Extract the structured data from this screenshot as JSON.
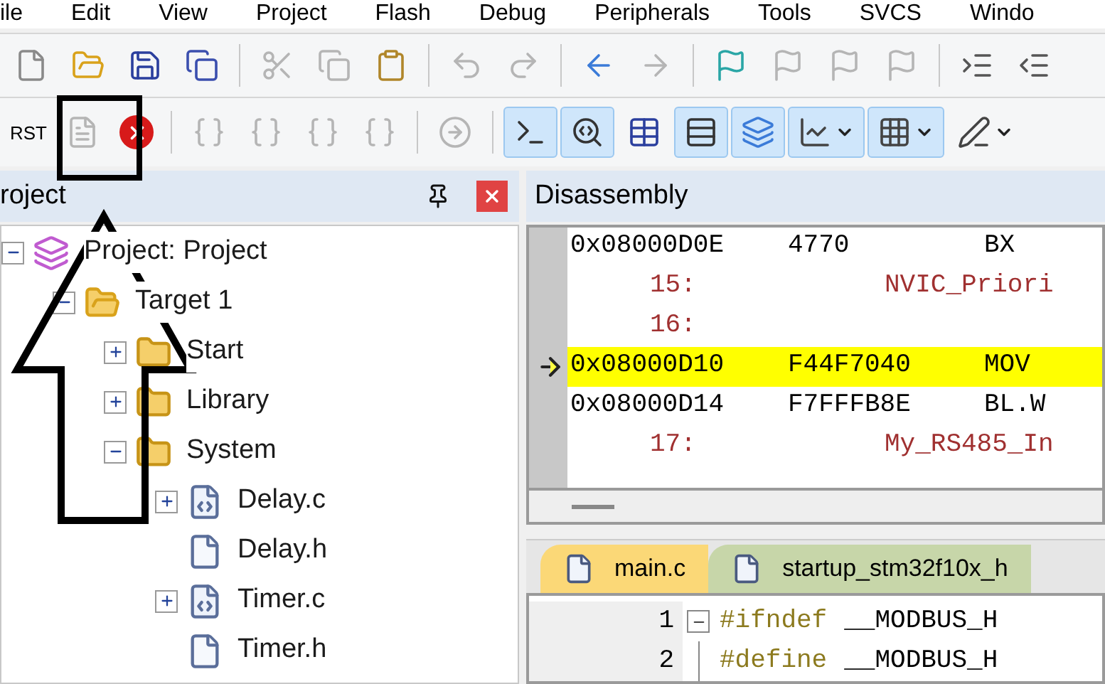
{
  "menu": [
    "ile",
    "Edit",
    "View",
    "Project",
    "Flash",
    "Debug",
    "Peripherals",
    "Tools",
    "SVCS",
    "Windo"
  ],
  "toolbar_1": [
    {
      "kind": "new",
      "disabled": false
    },
    {
      "kind": "open",
      "disabled": false
    },
    {
      "kind": "save",
      "disabled": false
    },
    {
      "kind": "save-all",
      "disabled": false
    },
    {
      "kind": "sep"
    },
    {
      "kind": "cut",
      "disabled": true
    },
    {
      "kind": "copy",
      "disabled": true
    },
    {
      "kind": "paste",
      "disabled": false
    },
    {
      "kind": "sep"
    },
    {
      "kind": "undo",
      "disabled": true
    },
    {
      "kind": "redo",
      "disabled": true
    },
    {
      "kind": "sep"
    },
    {
      "kind": "back",
      "disabled": false
    },
    {
      "kind": "forward",
      "disabled": true
    },
    {
      "kind": "sep"
    },
    {
      "kind": "flag",
      "disabled": false
    },
    {
      "kind": "flag-prev",
      "disabled": true
    },
    {
      "kind": "flag-next",
      "disabled": true
    },
    {
      "kind": "flag-clear",
      "disabled": true
    },
    {
      "kind": "sep"
    },
    {
      "kind": "indent",
      "disabled": false
    },
    {
      "kind": "outdent",
      "disabled": false
    }
  ],
  "toolbar_2": [
    {
      "kind": "reset",
      "label": "RST",
      "disabled": false
    },
    {
      "kind": "step-doc",
      "disabled": true
    },
    {
      "kind": "stop",
      "disabled": false
    },
    {
      "kind": "sep"
    },
    {
      "kind": "step-into",
      "disabled": true
    },
    {
      "kind": "step-over",
      "disabled": true
    },
    {
      "kind": "step-out",
      "disabled": true
    },
    {
      "kind": "run-cursor",
      "disabled": true
    },
    {
      "kind": "sep"
    },
    {
      "kind": "next",
      "disabled": true
    },
    {
      "kind": "sep"
    },
    {
      "kind": "command",
      "selected": true,
      "disabled": false
    },
    {
      "kind": "disasm",
      "selected": true,
      "disabled": false
    },
    {
      "kind": "symbols",
      "selected": false,
      "disabled": false
    },
    {
      "kind": "registers",
      "selected": true,
      "disabled": false
    },
    {
      "kind": "callstack",
      "selected": true,
      "disabled": false
    },
    {
      "kind": "watch",
      "selected": true,
      "disabled": false,
      "dropdown": true
    },
    {
      "kind": "memory",
      "selected": true,
      "disabled": false,
      "dropdown": true
    },
    {
      "kind": "serial",
      "selected": false,
      "disabled": false,
      "dropdown": true
    }
  ],
  "project_panel": {
    "title": "roject",
    "tree": [
      {
        "label": "Project: Project",
        "kind": "project",
        "expanded": true,
        "children": [
          {
            "label": "Target 1",
            "kind": "target",
            "expanded": true,
            "children": [
              {
                "label": "Start",
                "kind": "folder",
                "expanded": false
              },
              {
                "label": "Library",
                "kind": "folder",
                "expanded": false
              },
              {
                "label": "System",
                "kind": "folder",
                "expanded": true,
                "children": [
                  {
                    "label": "Delay.c",
                    "kind": "source",
                    "expanded": false
                  },
                  {
                    "label": "Delay.h",
                    "kind": "header"
                  },
                  {
                    "label": "Timer.c",
                    "kind": "source",
                    "expanded": false
                  },
                  {
                    "label": "Timer.h",
                    "kind": "header"
                  }
                ]
              }
            ]
          }
        ]
      }
    ]
  },
  "disassembly": {
    "title": "Disassembly",
    "rows": [
      {
        "kind": "asm",
        "address": "0x08000D0E",
        "opcode": "4770",
        "mnemonic": "BX",
        "current": false
      },
      {
        "kind": "src",
        "line": "15:",
        "source": "NVIC_Priori"
      },
      {
        "kind": "src",
        "line": "16:",
        "source": ""
      },
      {
        "kind": "asm",
        "address": "0x08000D10",
        "opcode": "F44F7040",
        "mnemonic": "MOV",
        "current": true
      },
      {
        "kind": "asm",
        "address": "0x08000D14",
        "opcode": "F7FFFB8E",
        "mnemonic": "BL.W",
        "current": false
      },
      {
        "kind": "src",
        "line": "17:",
        "source": "My_RS485_In"
      }
    ]
  },
  "editor": {
    "tabs": [
      {
        "label": "main.c",
        "selected": true
      },
      {
        "label": "startup_stm32f10x_h",
        "selected": false
      }
    ],
    "lines": [
      {
        "number": "1",
        "directive": "#ifndef",
        "rest": "__MODBUS_H",
        "fold": true
      },
      {
        "number": "2",
        "directive": "#define",
        "rest": "__MODBUS_H",
        "fold": false
      }
    ]
  }
}
